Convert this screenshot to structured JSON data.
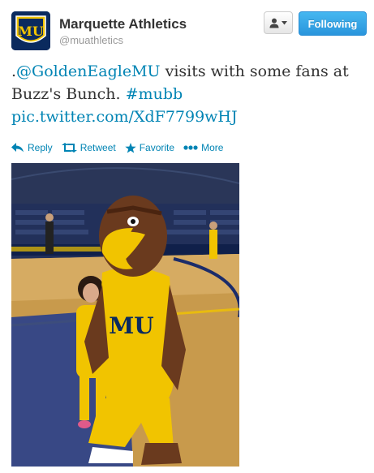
{
  "account": {
    "name": "Marquette Athletics",
    "handle": "@muathletics",
    "avatar_icon": "marquette-mu-logo",
    "avatar_text": "MU"
  },
  "buttons": {
    "user_actions_icon": "user-dropdown-icon",
    "follow_label": "Following"
  },
  "tweet": {
    "prefix": ".",
    "mention": "@GoldenEagleMU",
    "text_mid": " visits with some fans at Buzz's Bunch. ",
    "hashtag": "#mubb",
    "link": "pic.twitter.com/XdF7799wHJ"
  },
  "actions": [
    {
      "icon": "reply-icon",
      "label": "Reply"
    },
    {
      "icon": "retweet-icon",
      "label": "Retweet"
    },
    {
      "icon": "star-icon",
      "label": "Favorite"
    },
    {
      "icon": "more-icon",
      "label": "More"
    }
  ],
  "photo": {
    "description_icon": "mascot-photo",
    "jersey_text": "MU"
  },
  "colors": {
    "link": "#0084b4",
    "follow_button": "#2a95dc",
    "brand_navy": "#0a2a5e",
    "brand_gold": "#f1c400"
  }
}
